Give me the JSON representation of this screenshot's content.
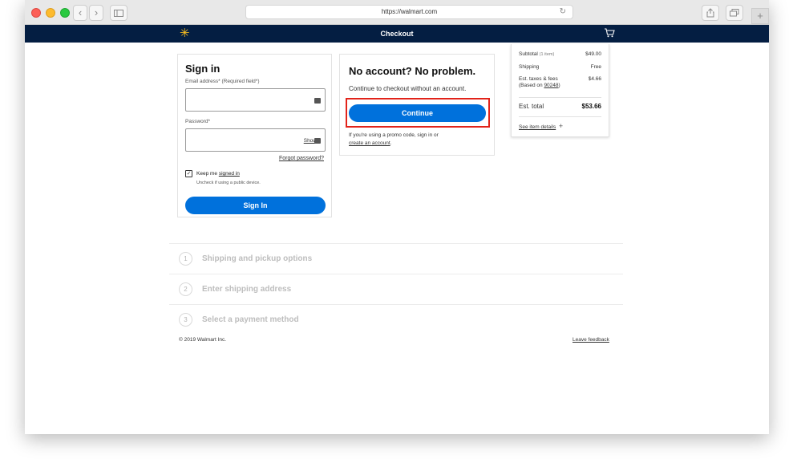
{
  "browser": {
    "url": "https://walmart.com",
    "back_icon": "chevron-left-icon",
    "forward_icon": "chevron-right-icon",
    "sidebar_icon": "sidebar-icon",
    "reload_icon": "reload-icon",
    "share_icon": "share-icon",
    "tabs_icon": "tabs-icon",
    "new_tab_label": "+"
  },
  "header": {
    "title": "Checkout",
    "logo_icon": "walmart-spark-icon",
    "cart_icon": "cart-icon",
    "bg_color": "#041e42",
    "spark_color": "#ffc220"
  },
  "signin": {
    "heading": "Sign in",
    "email_label": "Email address* (Required field*)",
    "email_value": "",
    "password_label": "Password*",
    "password_value": "",
    "show_label": "Show",
    "forgot_label": "Forgot password?",
    "keep_prefix": "Keep me ",
    "keep_link": "signed in",
    "keep_checked": true,
    "uncheck_note": "Uncheck if using a public device.",
    "button_label": "Sign In"
  },
  "guest": {
    "heading": "No account? No problem.",
    "subtext": "Continue to checkout without an account.",
    "button_label": "Continue",
    "promo_text": "If you're using a promo code, sign in or",
    "create_account_link": "create an account",
    "promo_suffix": "."
  },
  "summary": {
    "subtotal_label": "Subtotal",
    "subtotal_count": "(1 item)",
    "subtotal_value": "$49.00",
    "shipping_label": "Shipping",
    "shipping_value": "Free",
    "taxes_label": "Est. taxes & fees",
    "taxes_note_prefix": "(Based on ",
    "taxes_zip": "90248",
    "taxes_note_suffix": ")",
    "taxes_value": "$4.66",
    "total_label": "Est. total",
    "total_value": "$53.66",
    "details_link": "See item details",
    "details_plus": "+"
  },
  "steps": [
    {
      "number": "1",
      "label": "Shipping and pickup options"
    },
    {
      "number": "2",
      "label": "Enter shipping address"
    },
    {
      "number": "3",
      "label": "Select a payment method"
    }
  ],
  "footer": {
    "copyright": "© 2019 Walmart Inc.",
    "feedback": "Leave feedback"
  },
  "colors": {
    "accent": "#0071dc",
    "highlight": "#e2231a"
  }
}
